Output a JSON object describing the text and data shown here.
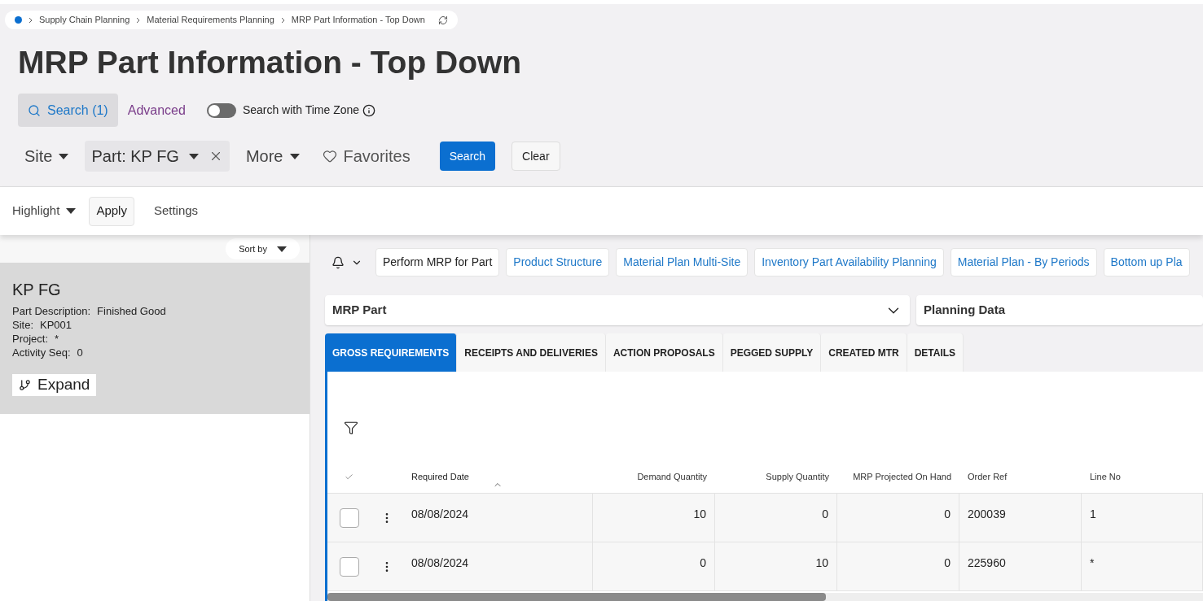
{
  "breadcrumb": [
    "Supply Chain Planning",
    "Material Requirements Planning",
    "MRP Part Information - Top Down"
  ],
  "title": "MRP Part Information - Top Down",
  "search_bar": {
    "search": "Search (1)",
    "search_selected": true,
    "advanced": "Advanced",
    "toggle_label": "Search with Time Zone",
    "toggle_on": false
  },
  "filters": [
    {
      "label": "Site",
      "kind": "dropdown"
    },
    {
      "label": "Part: KP FG",
      "kind": "chip"
    },
    {
      "label": "More",
      "kind": "dropdown"
    },
    {
      "label": "Favorites",
      "kind": "favorites"
    }
  ],
  "filter_buttons": {
    "search": "Search",
    "clear": "Clear"
  },
  "command_bar": {
    "highlight": "Highlight",
    "apply": "Apply",
    "settings": "Settings"
  },
  "sort_by": "Sort by",
  "card": {
    "title": "KP FG",
    "fields": [
      {
        "label": "Part Description:",
        "value": "Finished Good"
      },
      {
        "label": "Site:",
        "value": "KP001"
      },
      {
        "label": "Project:",
        "value": "*"
      },
      {
        "label": "Activity Seq:",
        "value": "0"
      }
    ],
    "expand": "Expand"
  },
  "actions": [
    {
      "label": "Perform MRP for Part",
      "kind": "command"
    },
    {
      "label": "Product Structure",
      "kind": "link"
    },
    {
      "label": "Material Plan Multi-Site",
      "kind": "link"
    },
    {
      "label": "Inventory Part Availability Planning",
      "kind": "link"
    },
    {
      "label": "Material Plan - By Periods",
      "kind": "link"
    },
    {
      "label": "Bottom up Pla",
      "kind": "link"
    }
  ],
  "selectors": [
    {
      "label": "MRP Part",
      "kind": "dropdown"
    },
    {
      "label": "Planning Data",
      "kind": "heading"
    }
  ],
  "tabs": [
    {
      "label": "GROSS REQUIREMENTS",
      "selected": true
    },
    {
      "label": "RECEIPTS AND DELIVERIES",
      "selected": false
    },
    {
      "label": "ACTION PROPOSALS",
      "selected": false
    },
    {
      "label": "PEGGED SUPPLY",
      "selected": false
    },
    {
      "label": "CREATED MTR",
      "selected": false
    },
    {
      "label": "DETAILS",
      "selected": false
    }
  ],
  "table": {
    "columns": [
      {
        "label": "Required Date",
        "kind": "text",
        "sorted": true
      },
      {
        "label": "Demand Quantity",
        "kind": "number",
        "sorted": false
      },
      {
        "label": "Supply Quantity",
        "kind": "number",
        "sorted": false
      },
      {
        "label": "MRP Projected On Hand",
        "kind": "number",
        "sorted": false
      },
      {
        "label": "Order Ref",
        "kind": "text",
        "sorted": false
      },
      {
        "label": "Line No",
        "kind": "text",
        "sorted": false
      }
    ],
    "rows": [
      {
        "checked": false,
        "cells": [
          "08/08/2024",
          "10",
          "0",
          "0",
          "200039",
          "1"
        ]
      },
      {
        "checked": false,
        "cells": [
          "08/08/2024",
          "0",
          "10",
          "0",
          "225960",
          "*"
        ]
      }
    ]
  }
}
